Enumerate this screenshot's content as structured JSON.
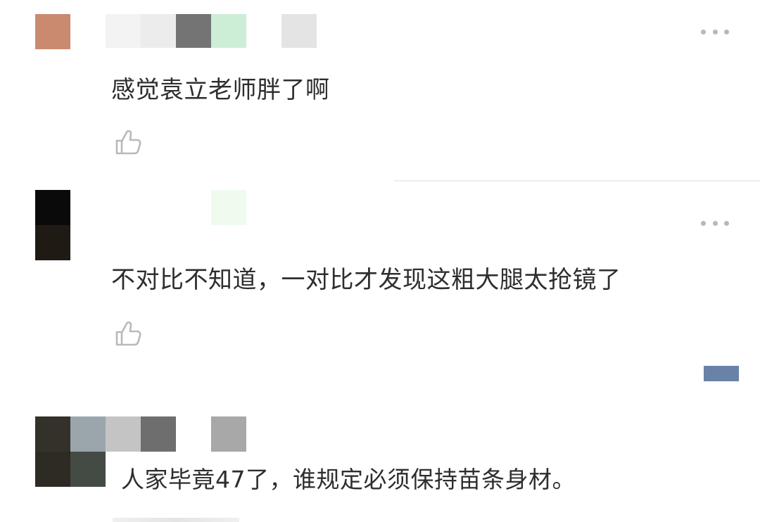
{
  "comments": [
    {
      "text": "感觉袁立老师胖了啊",
      "more_icon": "more-horizontal-icon",
      "like_icon": "thumbs-up-icon"
    },
    {
      "text": "不对比不知道，一对比才发现这粗大腿太抢镜了",
      "more_icon": "more-horizontal-icon",
      "like_icon": "thumbs-up-icon"
    },
    {
      "text": "人家毕竟47了，谁规定必须保持苗条身材。"
    }
  ],
  "mosaic_colors": {
    "avatar_1": [
      "#c98a70"
    ],
    "name_1": [
      "#f3f3f3",
      "#ececec",
      "#747474",
      "#cdeed6",
      "#ffffff",
      "#e4e4e4"
    ],
    "avatar_2": [
      "#0a0a0a",
      "#1f1a14"
    ],
    "name_2": [
      "#eefbee"
    ],
    "avatar_3": [
      "#34302a",
      "#9aa6ac",
      "#2e2b24",
      "#444b44"
    ],
    "name_3": [
      "#c4c4c4",
      "#6e6e6e",
      "#ffffff",
      "#a8a8a8"
    ],
    "tag": "#6a82a8"
  }
}
